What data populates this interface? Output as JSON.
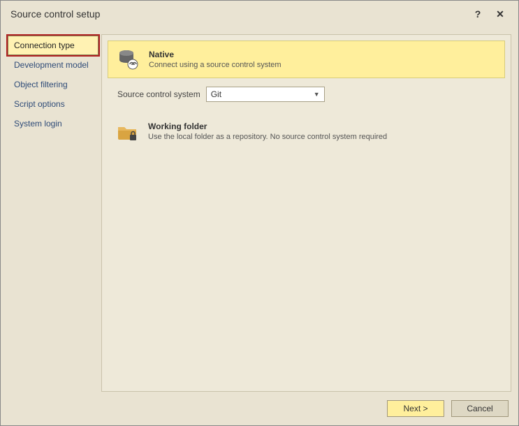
{
  "title": "Source control setup",
  "sidebar": {
    "items": [
      {
        "label": "Connection type",
        "selected": true
      },
      {
        "label": "Development model",
        "selected": false
      },
      {
        "label": "Object filtering",
        "selected": false
      },
      {
        "label": "Script options",
        "selected": false
      },
      {
        "label": "System login",
        "selected": false
      }
    ]
  },
  "options": {
    "native": {
      "title": "Native",
      "desc": "Connect using a source control system"
    },
    "workingfolder": {
      "title": "Working folder",
      "desc": "Use the local folder as a repository. No source control system required"
    }
  },
  "form": {
    "scs_label": "Source control system",
    "scs_value": "Git"
  },
  "footer": {
    "next": "Next >",
    "cancel": "Cancel"
  }
}
